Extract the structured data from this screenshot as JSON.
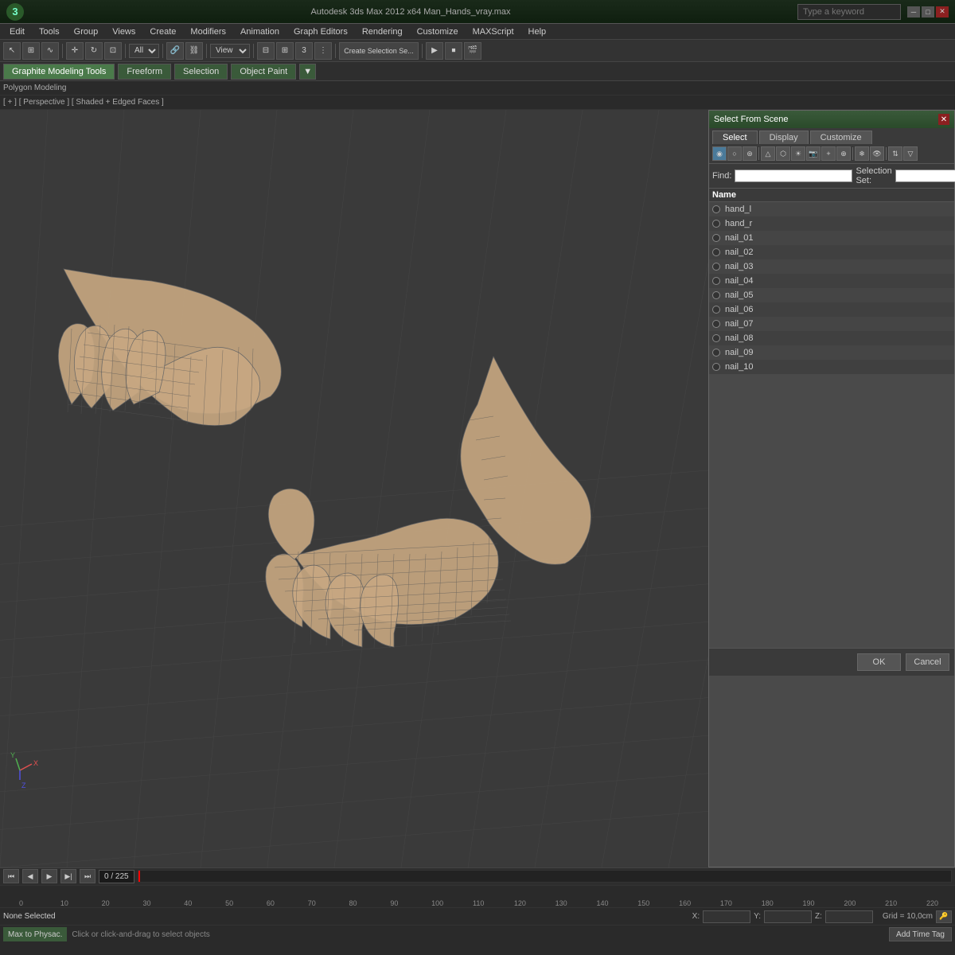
{
  "titlebar": {
    "logo": "3",
    "title": "Autodesk 3ds Max 2012 x64     Man_Hands_vray.max",
    "search_placeholder": "Type a keyword",
    "min_btn": "─",
    "max_btn": "□",
    "close_btn": "✕"
  },
  "menubar": {
    "items": [
      "Edit",
      "Tools",
      "Group",
      "Views",
      "Create",
      "Modifiers",
      "Animation",
      "Graph Editors",
      "Rendering",
      "Customize",
      "MAXScript",
      "Help"
    ]
  },
  "toolbar": {
    "items": [
      "⊕",
      "↖",
      "⊞",
      "∼",
      "⟳",
      "↔",
      "⊡",
      "◉",
      "⊕",
      "⊕",
      "□",
      "⊞"
    ]
  },
  "toolbar2": {
    "tabs": [
      "Graphite Modeling Tools",
      "Freeform",
      "Selection",
      "Object Paint"
    ],
    "active_tab": "Graphite Modeling Tools"
  },
  "modeling_bar": {
    "label": "Polygon Modeling"
  },
  "viewport_header": {
    "label": "[ + ] [ Perspective ] [ Shaded + Edged Faces ]"
  },
  "dialog": {
    "title": "Select From Scene",
    "tabs": [
      "Select",
      "Display",
      "Customize"
    ],
    "active_tab": "Select",
    "find_label": "Find:",
    "find_value": "",
    "sel_set_label": "Selection Set:",
    "sel_set_value": "",
    "list_header": "Name",
    "items": [
      {
        "name": "hand_l",
        "selected": false
      },
      {
        "name": "hand_r",
        "selected": false
      },
      {
        "name": "nail_01",
        "selected": false
      },
      {
        "name": "nail_02",
        "selected": false
      },
      {
        "name": "nail_03",
        "selected": false
      },
      {
        "name": "nail_04",
        "selected": false
      },
      {
        "name": "nail_05",
        "selected": false
      },
      {
        "name": "nail_06",
        "selected": false
      },
      {
        "name": "nail_07",
        "selected": false
      },
      {
        "name": "nail_08",
        "selected": false
      },
      {
        "name": "nail_09",
        "selected": false
      },
      {
        "name": "nail_10",
        "selected": false
      }
    ],
    "ok_label": "OK",
    "cancel_label": "Cancel"
  },
  "timeline": {
    "frame_display": "0 / 225",
    "ticks": [
      "0",
      "10",
      "20",
      "30",
      "40",
      "50",
      "60",
      "70",
      "80",
      "90",
      "100",
      "110",
      "120",
      "130",
      "140",
      "150",
      "160",
      "170",
      "180",
      "190",
      "200",
      "210",
      "220"
    ]
  },
  "statusbar": {
    "none_selected": "None Selected",
    "hint": "Click or click-and-drag to select objects",
    "x_label": "X:",
    "y_label": "Y:",
    "z_label": "Z:",
    "x_value": "",
    "y_value": "",
    "z_value": "",
    "grid_label": "Grid = 10,0cm",
    "max_physac": "Max to Physac.",
    "add_time_tag": "Add Time Tag"
  }
}
